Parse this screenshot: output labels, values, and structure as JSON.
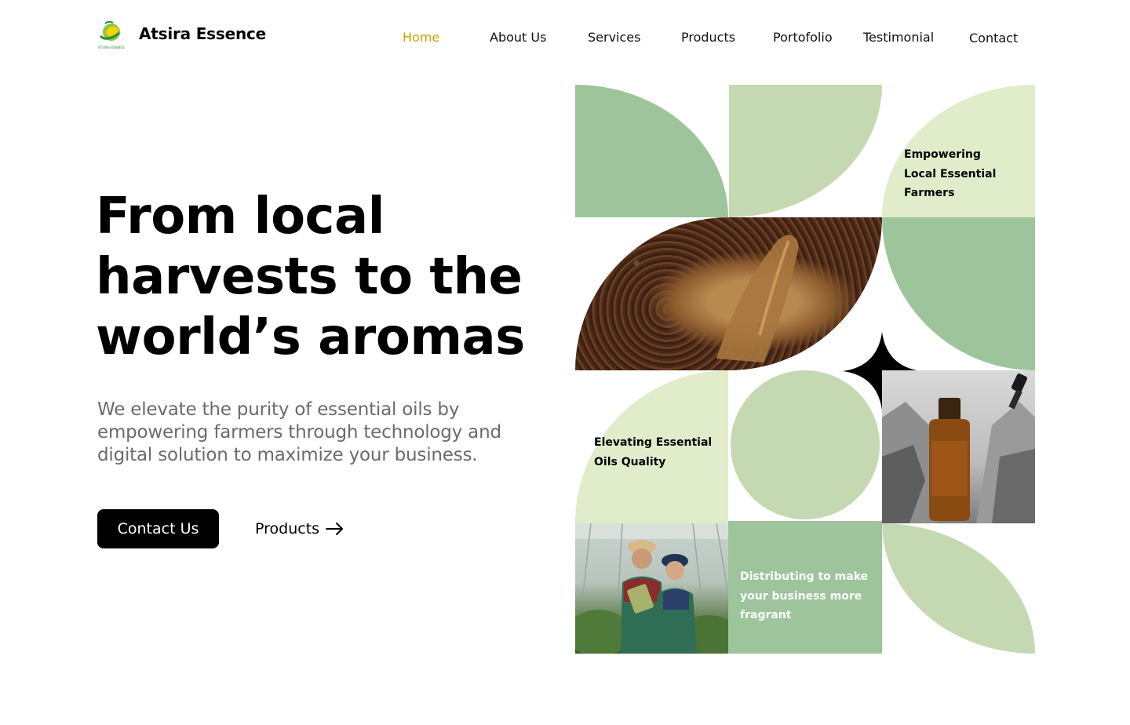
{
  "brand": {
    "name": "Atsira Essence",
    "logo_text": "ATSIRA ESSENCE"
  },
  "nav": {
    "items": [
      {
        "label": "Home"
      },
      {
        "label": "About Us"
      },
      {
        "label": "Services"
      },
      {
        "label": "Products"
      },
      {
        "label": "Portofolio"
      },
      {
        "label": "Testimonial"
      },
      {
        "label": "Contact"
      }
    ]
  },
  "hero": {
    "headline_lines": [
      "From local",
      "harvests to the",
      "world’s aromas"
    ],
    "subtext": "We elevate the purity of essential oils by empowering farmers through technology and digital solution to maximize your business.",
    "primary_button": "Contact Us",
    "secondary_button": "Products"
  },
  "mosaic": {
    "caption_farmers": [
      "Empowering",
      "Local Essential",
      "Farmers"
    ],
    "caption_quality": [
      "Elevating Essential",
      "Oils Quality"
    ],
    "caption_distributing": [
      "Distributing to make",
      "your business more",
      "fragrant"
    ]
  },
  "colors": {
    "accent": "#c9a200",
    "green_dark": "#9dc49b",
    "green_mid": "#c4d9b2",
    "green_light": "#e0ecca",
    "button_bg": "#000000"
  },
  "icons": {
    "logo": "leaf-sun-logo",
    "arrow": "arrow-right-icon",
    "sparkle": "four-point-star-icon"
  }
}
